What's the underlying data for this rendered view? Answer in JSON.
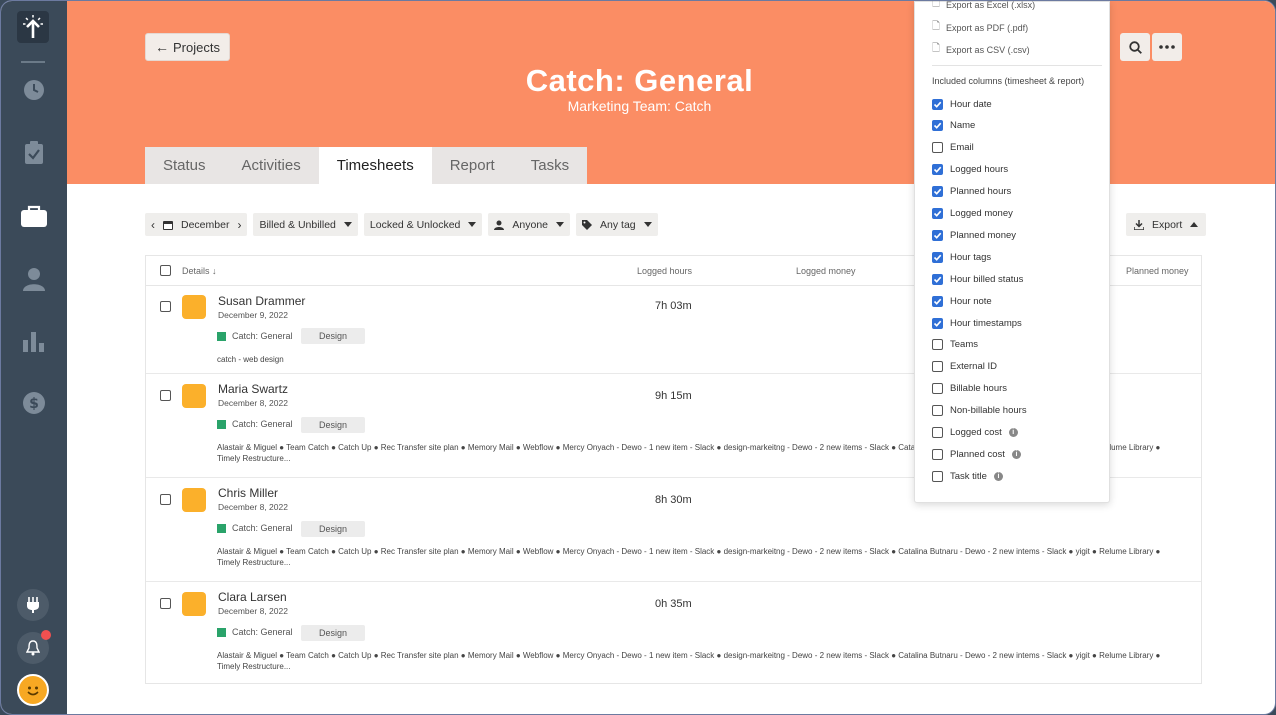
{
  "colors": {
    "header": "#fb8d64",
    "sidebar": "#3b4a59",
    "accent": "#2f6fd6",
    "project_square": "#fbb02b",
    "project_dot": "#2aa36a"
  },
  "sidebar": {
    "icons": [
      "logo-icon",
      "clock-icon",
      "clipboard-icon",
      "briefcase-icon",
      "user-icon",
      "chart-icon",
      "dollar-icon"
    ],
    "bottom": [
      "plug-icon",
      "bell-icon",
      "avatar"
    ]
  },
  "header": {
    "back_label": "Projects",
    "title": "Catch: General",
    "subtitle": "Marketing Team: Catch",
    "tabs": [
      {
        "label": "Status"
      },
      {
        "label": "Activities"
      },
      {
        "label": "Timesheets"
      },
      {
        "label": "Report"
      },
      {
        "label": "Tasks"
      }
    ]
  },
  "filters": {
    "month": "December",
    "billing": "Billed & Unbilled",
    "lock": "Locked & Unlocked",
    "person": "Anyone",
    "tag": "Any tag",
    "export": "Export"
  },
  "table": {
    "headers": {
      "details": "Details ↓",
      "logged_hours": "Logged hours",
      "logged_money": "Logged money",
      "planned_money": "Planned money"
    },
    "rows": [
      {
        "name": "Susan Drammer",
        "date": "December 9, 2022",
        "project": "Catch: General",
        "tag": "Design",
        "hours": "7h 03m",
        "note": "catch - web design"
      },
      {
        "name": "Maria Swartz",
        "date": "December 8, 2022",
        "project": "Catch: General",
        "tag": "Design",
        "hours": "9h 15m",
        "note": "Alastair & Miguel ● Team Catch ● Catch Up ● Rec Transfer site plan ● Memory Mail ● Webflow ● Mercy Onyach - Dewo - 1 new item - Slack ● design-markeitng - Dewo - 2 new items - Slack ● Catalina Butnaru - Dewo - 2 new intems - Slack ● yigit ● Relume Library ● Timely Restructure..."
      },
      {
        "name": "Chris Miller",
        "date": "December 8, 2022",
        "project": "Catch: General",
        "tag": "Design",
        "hours": "8h 30m",
        "note": "Alastair & Miguel ● Team Catch ● Catch Up ● Rec Transfer site plan ● Memory Mail ● Webflow ● Mercy Onyach - Dewo - 1 new item - Slack ● design-markeitng - Dewo - 2 new items - Slack ● Catalina Butnaru - Dewo - 2 new intems - Slack ● yigit ● Relume Library ● Timely Restructure..."
      },
      {
        "name": "Clara Larsen",
        "date": "December 8, 2022",
        "project": "Catch: General",
        "tag": "Design",
        "hours": "0h 35m",
        "note": "Alastair & Miguel ● Team Catch ● Catch Up ● Rec Transfer site plan ● Memory Mail ● Webflow ● Mercy Onyach - Dewo - 1 new item - Slack ● design-markeitng - Dewo - 2 new items - Slack ● Catalina Butnaru - Dewo - 2 new intems - Slack ● yigit ● Relume Library ● Timely Restructure..."
      }
    ]
  },
  "dropdown": {
    "exports": [
      "Export as Excel (.xlsx)",
      "Export as PDF (.pdf)",
      "Export as CSV (.csv)"
    ],
    "columns_heading": "Included columns (timesheet & report)",
    "columns": [
      {
        "label": "Hour date",
        "checked": true
      },
      {
        "label": "Name",
        "checked": true
      },
      {
        "label": "Email",
        "checked": false
      },
      {
        "label": "Logged hours",
        "checked": true
      },
      {
        "label": "Planned hours",
        "checked": true
      },
      {
        "label": "Logged money",
        "checked": true
      },
      {
        "label": "Planned money",
        "checked": true
      },
      {
        "label": "Hour tags",
        "checked": true
      },
      {
        "label": "Hour billed status",
        "checked": true
      },
      {
        "label": "Hour note",
        "checked": true
      },
      {
        "label": "Hour timestamps",
        "checked": true
      },
      {
        "label": "Teams",
        "checked": false
      },
      {
        "label": "External ID",
        "checked": false
      },
      {
        "label": "Billable hours",
        "checked": false
      },
      {
        "label": "Non-billable hours",
        "checked": false
      },
      {
        "label": "Logged cost",
        "checked": false,
        "info": true
      },
      {
        "label": "Planned cost",
        "checked": false,
        "info": true
      },
      {
        "label": "Task title",
        "checked": false,
        "info": true
      }
    ]
  }
}
